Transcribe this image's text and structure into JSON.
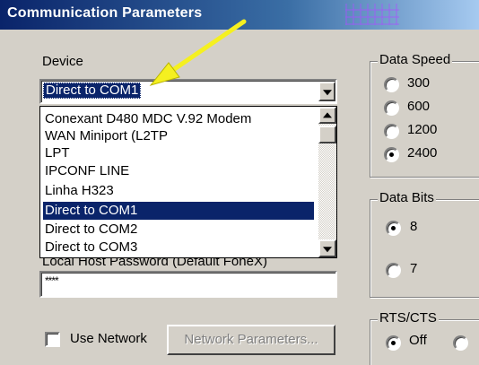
{
  "window": {
    "title": "Communication Parameters"
  },
  "device": {
    "label": "Device",
    "selected": "Direct to COM1",
    "options": [
      "Conexant D480 MDC V.92 Modem",
      "WAN Miniport (L2TP",
      "LPT",
      "IPCONF LINE",
      "Linha H323",
      "Direct to COM1",
      "Direct to COM2",
      "Direct to COM3"
    ],
    "highlighted_index": 5
  },
  "password": {
    "label": "Local Host Password (Default FoneX)",
    "value": "****"
  },
  "data_speed": {
    "label": "Data Speed",
    "options": [
      "300",
      "600",
      "1200",
      "2400"
    ],
    "selected": "2400"
  },
  "data_bits": {
    "label": "Data Bits",
    "options": [
      "8",
      "7"
    ],
    "selected": "8"
  },
  "rts_cts": {
    "label": "RTS/CTS",
    "options": [
      "Off",
      ""
    ],
    "selected": "Off"
  },
  "network": {
    "use_label": "Use Network",
    "checked": false,
    "params_button": "Network Parameters..."
  },
  "colors": {
    "titlebar": "#0a246a",
    "face": "#d4d0c8",
    "selection": "#0a246a",
    "annotation_arrow": "#f5f020"
  }
}
